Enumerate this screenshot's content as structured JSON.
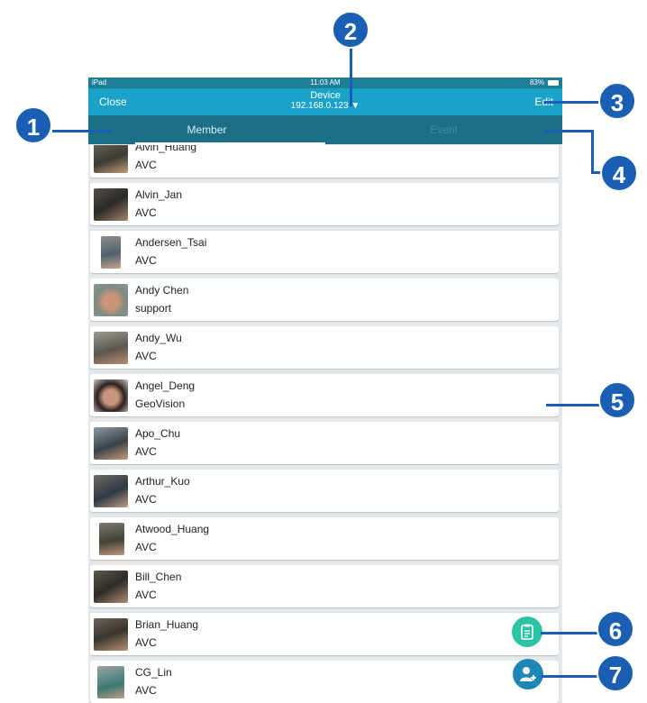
{
  "status_bar": {
    "device": "iPad",
    "time": "11:03 AM",
    "battery": "83%"
  },
  "nav": {
    "close_label": "Close",
    "title": "Device",
    "subtitle": "192.168.0.123 ▼",
    "edit_label": "Edit"
  },
  "tabs": [
    {
      "label": "Member"
    },
    {
      "label": "Event"
    }
  ],
  "members": [
    {
      "name": "Alvin_Huang",
      "group": "AVC"
    },
    {
      "name": "Alvin_Jan",
      "group": "AVC"
    },
    {
      "name": "Andersen_Tsai",
      "group": "AVC"
    },
    {
      "name": "Andy Chen",
      "group": "support"
    },
    {
      "name": "Andy_Wu",
      "group": "AVC"
    },
    {
      "name": "Angel_Deng",
      "group": "GeoVision"
    },
    {
      "name": "Apo_Chu",
      "group": "AVC"
    },
    {
      "name": "Arthur_Kuo",
      "group": "AVC"
    },
    {
      "name": "Atwood_Huang",
      "group": "AVC"
    },
    {
      "name": "Bill_Chen",
      "group": "AVC"
    },
    {
      "name": "Brian_Huang",
      "group": "AVC"
    },
    {
      "name": "CG_Lin",
      "group": "AVC"
    }
  ],
  "callouts": [
    "1",
    "2",
    "3",
    "4",
    "5",
    "6",
    "7"
  ],
  "icons": {
    "report": "clipboard-icon",
    "add": "add-person-icon"
  },
  "colors": {
    "navbar": "#1aa2c8",
    "tabbar": "#1c6f86",
    "callout": "#1a5fb4",
    "fab_report": "#2cc3a4",
    "fab_add": "#1f86b6"
  }
}
